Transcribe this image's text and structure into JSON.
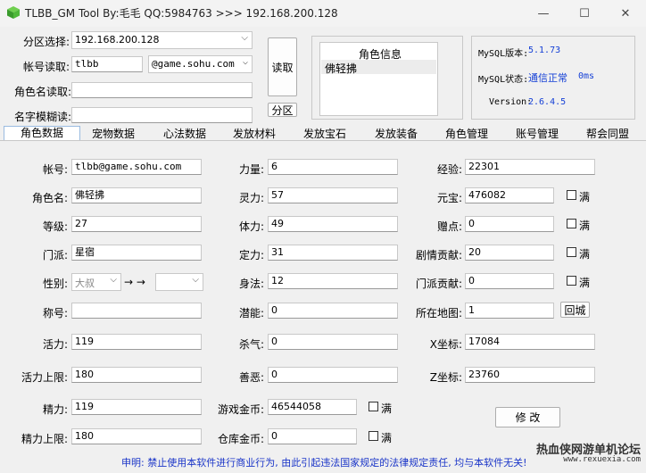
{
  "window": {
    "title": "TLBB_GM Tool By:毛毛 QQ:5984763 >>> 192.168.200.128",
    "buttons": {
      "minimize": "—",
      "maximize": "☐",
      "close": "✕"
    }
  },
  "login": {
    "region_label": "分区选择:",
    "region_value": "192.168.200.128",
    "account_label": "帐号读取:",
    "account_value": "tlbb",
    "domain_value": "@game.sohu.com",
    "role_name_label": "角色名读取:",
    "role_name_value": "",
    "fuzzy_label": "名字模糊读:",
    "fuzzy_value": "",
    "read_button": "读取",
    "region_button": "分区"
  },
  "role_info": {
    "title": "角色信息",
    "items": [
      "佛轻拂"
    ]
  },
  "mysql": {
    "version_label": "MySQL版本:",
    "version_value": "5.1.73",
    "status_label": "MySQL状态:",
    "status_value": "通信正常",
    "latency_value": "0ms",
    "app_version_label": "Version:",
    "app_version_value": "2.6.4.5",
    "value_color": "#1540d6"
  },
  "tabs": [
    "角色数据",
    "宠物数据",
    "心法数据",
    "发放材料",
    "发放宝石",
    "发放装备",
    "角色管理",
    "账号管理",
    "帮会同盟"
  ],
  "col1": {
    "account_label": "帐号:",
    "account_value": "tlbb@game.sohu.com",
    "role_label": "角色名:",
    "role_value": "佛轻拂",
    "level_label": "等级:",
    "level_value": "27",
    "school_label": "门派:",
    "school_value": "星宿",
    "gender_label": "性别:",
    "gender_value": "大叔",
    "arrows": "→ →",
    "gender_new_value": "",
    "title_label": "称号:",
    "title_value": "",
    "vigor_label": "活力:",
    "vigor_value": "119",
    "vigor_max_label": "活力上限:",
    "vigor_max_value": "180",
    "energy_label": "精力:",
    "energy_value": "119",
    "energy_max_label": "精力上限:",
    "energy_max_value": "180"
  },
  "col2": {
    "str_label": "力量:",
    "str_value": "6",
    "spr_label": "灵力:",
    "spr_value": "57",
    "con_label": "体力:",
    "con_value": "49",
    "foc_label": "定力:",
    "foc_value": "31",
    "agi_label": "身法:",
    "agi_value": "12",
    "pot_label": "潜能:",
    "pot_value": "0",
    "kill_label": "杀气:",
    "kill_value": "0",
    "moral_label": "善恶:",
    "moral_value": "0",
    "gold_label": "游戏金币:",
    "gold_value": "46544058",
    "bank_label": "仓库金币:",
    "bank_value": "0",
    "full_label": "满"
  },
  "col3": {
    "exp_label": "经验:",
    "exp_value": "22301",
    "yb_label": "元宝:",
    "yb_value": "476082",
    "gift_label": "赠点:",
    "gift_value": "0",
    "story_label": "剧情贡献:",
    "story_value": "20",
    "school_contrib_label": "门派贡献:",
    "school_contrib_value": "0",
    "map_label": "所在地图:",
    "map_value": "1",
    "return_city_button": "回城",
    "x_label": "X坐标:",
    "x_value": "17084",
    "z_label": "Z坐标:",
    "z_value": "23760",
    "full_label": "满"
  },
  "modify_button": "修 改",
  "footer": {
    "notice": "申明: 禁止使用本软件进行商业行为, 由此引起违法国家规定的法律规定责任, 均与本软件无关!",
    "watermark_line1": "热血侠网游单机论坛",
    "watermark_line2": "www.rexuexia.com"
  }
}
